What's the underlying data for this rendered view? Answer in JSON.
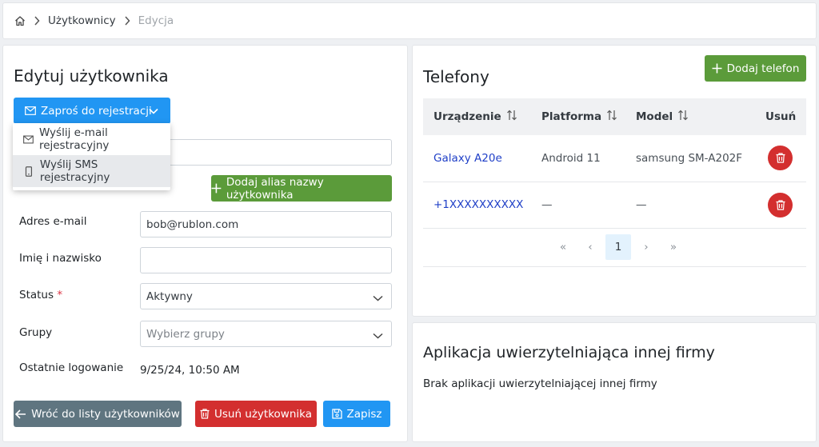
{
  "breadcrumb": {
    "home_icon": "home-icon",
    "users": "Użytkownicy",
    "current": "Edycja"
  },
  "edit": {
    "title": "Edytuj użytkownika",
    "invite_label": "Zaproś do rejestracji",
    "invite_menu": [
      {
        "label": "Wyślij e-mail rejestracyjny",
        "icon": "mail-icon"
      },
      {
        "label": "Wyślij SMS rejestracyjny",
        "icon": "phone-icon"
      }
    ],
    "add_alias_label": "Dodaj alias nazwy użytkownika",
    "fields": {
      "email_label": "Adres e-mail",
      "email_value": "bob@rublon.com",
      "name_label": "Imię i nazwisko",
      "name_value": "",
      "status_label": "Status",
      "status_required": "*",
      "status_value": "Aktywny",
      "groups_label": "Grupy",
      "groups_placeholder": "Wybierz grupy",
      "last_login_label": "Ostatnie logowanie",
      "last_login_value": "9/25/24, 10:50 AM"
    },
    "back_label": "Wróć do listy użytkowników",
    "delete_label": "Usuń użytkownika",
    "save_label": "Zapisz"
  },
  "phones": {
    "title": "Telefony",
    "add_label": "Dodaj telefon",
    "columns": [
      "Urządzenie",
      "Platforma",
      "Model",
      "Usuń"
    ],
    "rows": [
      {
        "device": "Galaxy A20e",
        "platform": "Android 11",
        "model": "samsung SM-A202F"
      },
      {
        "device": "+1XXXXXXXXXX",
        "platform": "—",
        "model": "—"
      }
    ],
    "pager": {
      "first": "«",
      "prev": "‹",
      "page": "1",
      "next": "›",
      "last": "»"
    }
  },
  "apps": {
    "title": "Aplikacja uwierzytelniająca innej firmy",
    "empty_text": "Brak aplikacji uwierzytelniającej innej firmy"
  },
  "colors": {
    "primary": "#2196f3",
    "success": "#5b9b3a",
    "danger": "#d32f2f",
    "secondary": "#5f7580"
  }
}
